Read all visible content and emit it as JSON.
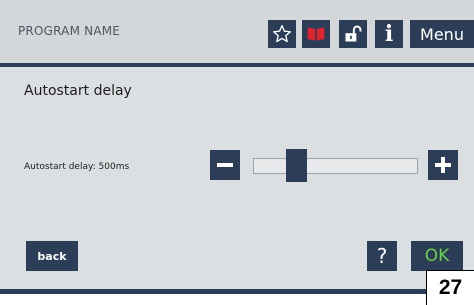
{
  "header": {
    "program_name": "PROGRAM NAME",
    "buttons": [
      {
        "icon": "star-icon"
      },
      {
        "icon": "book-icon",
        "color": "#e0242f"
      },
      {
        "icon": "unlock-icon"
      },
      {
        "label": "i"
      },
      {
        "label": "Menu"
      }
    ]
  },
  "page": {
    "title": "Autostart delay"
  },
  "setting": {
    "label": "Autostart delay: 500ms",
    "slider_fraction": 0.23
  },
  "footer": {
    "back_label": "back",
    "help_label": "?",
    "ok_label": "OK",
    "ok_color": "#69d04a"
  },
  "page_badge": "27",
  "colors": {
    "button": "#2c3e57",
    "background": "#dcdfe2"
  }
}
